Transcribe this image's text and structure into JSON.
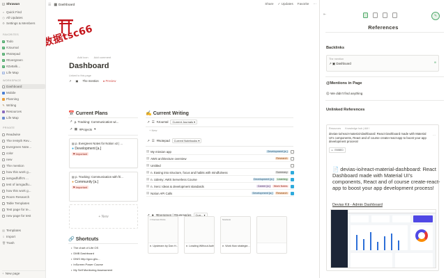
{
  "window": {
    "breadcrumb": "Dashboard"
  },
  "topbar": {
    "share": "Share",
    "updates": "Updates",
    "favorite": "Favorite"
  },
  "sidebar": {
    "workspace": "Shrawan",
    "top_items": [
      "Quick Find",
      "All Updates",
      "Settings & Members"
    ],
    "favorites_label": "FAVORITES",
    "favorites": [
      "Todo",
      "#Journal",
      "#Notepad",
      "#Evergreen",
      "#Zettelk...",
      "Life Map"
    ],
    "workspace_label": "WORKSPACE",
    "workspace_items": [
      "Dashboard",
      "Mobile",
      "Planning",
      "Writing",
      "Resources",
      "Life Map"
    ],
    "private_label": "PRIVATE",
    "private_items": [
      "Readwise",
      "The 8-Myth Rev...",
      "Evergreen Note...",
      "color",
      "new",
      "The mention",
      "how this work g...",
      "iamgadfuffs's ...",
      "test of iamgadfu...",
      "how this work g...",
      "Room Research",
      "Table Templates",
      "Test page for te...",
      "new page for test"
    ],
    "bottom_items": [
      "Templates",
      "Import",
      "Trash"
    ],
    "new_page": "New page"
  },
  "main": {
    "seal_text": "数据tsc66",
    "add_icon": "Add icon",
    "add_comment": "Add comment",
    "title": "Dashboard",
    "linked": "Linked to this page",
    "mention": "The mention",
    "preview": "Preview",
    "plans": {
      "heading": "Current Plans",
      "row1": "p. Tracking: Communication wi...",
      "view": "#Projects",
      "card1_title": "p. Evergreen Notes for Notion v2 | ...",
      "card1_tag": "Development [a.]",
      "card1_sub": "Important",
      "card2_title": "p. Tracking: Communication with fri...",
      "card2_tag": "Community [a.]",
      "card2_sub": "Important",
      "new_label": "+ New"
    },
    "writing": {
      "heading": "Current Writing",
      "journal": "#Journal",
      "journal_view": "Current Journals",
      "new_label": "+ New",
      "notepad": "#Notepad",
      "notepad_view": "Current Notebooks",
      "rows": [
        {
          "name": "My mission app",
          "tags": [
            {
              "t": "Development [a.]",
              "c": "blue"
            }
          ],
          "checked": false
        },
        {
          "name": "AWS architecture overview",
          "tags": [
            {
              "t": "Research",
              "c": "orange"
            }
          ],
          "checked": false
        },
        {
          "name": "Untitled",
          "tags": [],
          "checked": false
        },
        {
          "name": "n. Easing into structure, focus and habits with mindfulness",
          "tags": [
            {
              "t": "Summary",
              "c": "gray"
            }
          ],
          "checked": true
        },
        {
          "name": "n. Udemy: AWS Serverless Course",
          "tags": [
            {
              "t": "Development [a.]",
              "c": "blue"
            },
            {
              "t": "Learning",
              "c": "green"
            }
          ],
          "checked": true
        },
        {
          "name": "n. Xero: Ideas & development standards",
          "tags": [
            {
              "t": "Career [a.]",
              "c": "purple"
            },
            {
              "t": "Work Notes",
              "c": "red"
            }
          ],
          "checked": true
        },
        {
          "name": "Notion API Calls",
          "tags": [
            {
              "t": "Development [a.]",
              "c": "blue"
            },
            {
              "t": "Research",
              "c": "orange"
            }
          ],
          "checked": true
        }
      ],
      "evergreen": "#Evergreen | #Summaries",
      "evergreen_view": "Curr...",
      "cards": [
        {
          "preview": "// Overview Points",
          "caption": "e. Upstream by Dan H..."
        },
        {
          "preview": "",
          "caption": "e. Leading Without Autho..."
        },
        {
          "preview": "Notebook",
          "caption": "e. Work flow strategie..."
        },
        {
          "preview": "",
          "caption": ""
        }
      ]
    },
    "shortcuts": {
      "heading": "Shortcuts",
      "items": [
        "The chart of Life OS",
        "DMB Dashboard",
        "DNIS http://goo.gl/u...",
        "InScreen Power Course",
        "My Self Monitoring Assessment"
      ]
    }
  },
  "panel": {
    "title": "References",
    "backlinks": "Backlinks",
    "backlink_from": "The mention",
    "backlink_target": "Dashboard",
    "mentions": "Mentions in Page",
    "no_mentions": "We didn't find anything",
    "unlinked": "Unlinked References",
    "ref_source": "Resources",
    "ref_meta": "Knowledge hub | AM I",
    "ref_excerpt": "devias-io/react-material-dashboard: React Dashboard made with Material UI's components, React and of course create-react-app to boost your app development process!",
    "ref_badge": "EMBED",
    "ref_heading": "devias-io/react-material-dashboard: React Dashboard made with Material UI's components, React and of course create-react-app to boost your app development process!",
    "ref_link": "Devias Kit - Admin Dashboard"
  },
  "colors": {
    "accent": "#2eaadc",
    "seal": "#c4161c",
    "link_red": "#d44c47"
  }
}
